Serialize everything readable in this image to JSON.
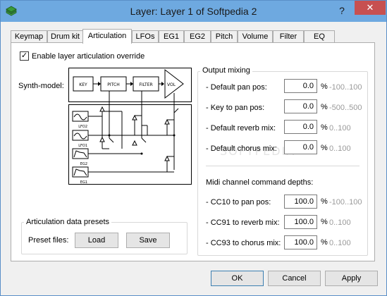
{
  "window": {
    "title": "Layer: Layer 1 of Softpedia 2",
    "help_glyph": "?",
    "close_glyph": "✕"
  },
  "tabs": [
    {
      "label": "Keymap"
    },
    {
      "label": "Drum kit"
    },
    {
      "label": "Articulation",
      "active": true
    },
    {
      "label": "LFOs"
    },
    {
      "label": "EG1"
    },
    {
      "label": "EG2"
    },
    {
      "label": "Pitch"
    },
    {
      "label": "Volume"
    },
    {
      "label": "Filter"
    },
    {
      "label": "EQ"
    }
  ],
  "articulation": {
    "enable_override_label": "Enable layer articulation override",
    "enable_override_checked": true,
    "synth_model_label": "Synth-model:",
    "diagram": {
      "blocks": [
        "KEY",
        "PITCH",
        "FILTER",
        "VOL"
      ],
      "sources": [
        "LFO2",
        "LFO1",
        "EG2",
        "EG1"
      ]
    },
    "presets": {
      "group_title": "Articulation data presets",
      "files_label": "Preset files:",
      "load_label": "Load",
      "save_label": "Save"
    },
    "output_mixing": {
      "group_title": "Output mixing",
      "rows": [
        {
          "label": "- Default pan pos:",
          "value": "0.0",
          "unit": "%",
          "range": "-100..100"
        },
        {
          "label": "- Key to pan pos:",
          "value": "0.0",
          "unit": "%",
          "range": "-500..500"
        },
        {
          "label": "- Default reverb mix:",
          "value": "0.0",
          "unit": "%",
          "range": "0..100"
        },
        {
          "label": "- Default chorus mix:",
          "value": "0.0",
          "unit": "%",
          "range": "0..100"
        }
      ],
      "midi_title": "Midi channel command depths:",
      "midi_rows": [
        {
          "label": "- CC10 to pan pos:",
          "value": "100.0",
          "unit": "%",
          "range": "-100..100"
        },
        {
          "label": "- CC91 to reverb mix:",
          "value": "100.0",
          "unit": "%",
          "range": "0..100"
        },
        {
          "label": "- CC93 to chorus mix:",
          "value": "100.0",
          "unit": "%",
          "range": "0..100"
        }
      ]
    }
  },
  "watermark": "SOFTPEDIA",
  "buttons": {
    "ok": "OK",
    "cancel": "Cancel",
    "apply": "Apply"
  },
  "colors": {
    "titlebar": "#6ea9e0",
    "close": "#c75050",
    "default_button_border": "#3c7fb1"
  }
}
